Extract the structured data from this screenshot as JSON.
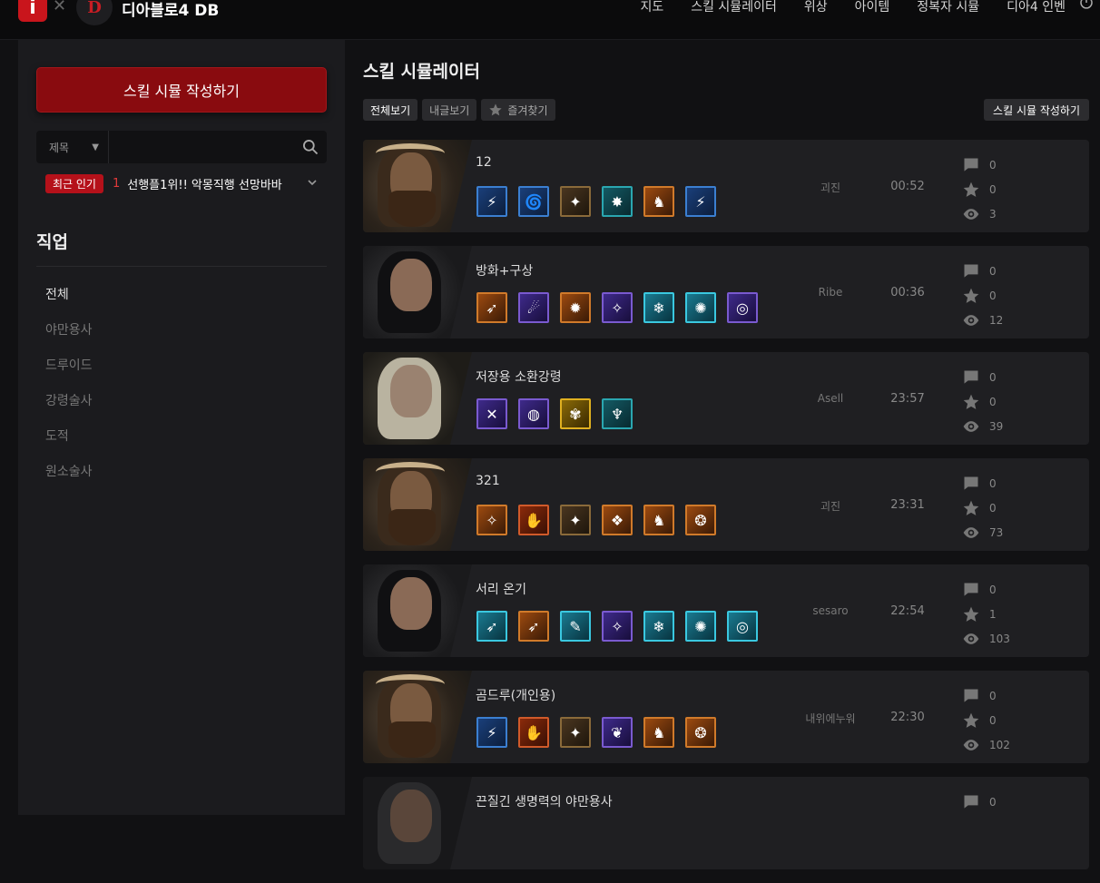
{
  "header": {
    "site_title": "디아블로4 DB",
    "logo_text": "i",
    "logo_d": "D",
    "nav": [
      "지도",
      "스킬 시뮬레이터",
      "위상",
      "아이템",
      "정복자 시뮬",
      "디아4 인벤"
    ]
  },
  "sidebar": {
    "write_button": "스킬 시뮬 작성하기",
    "search": {
      "select_label": "제목",
      "placeholder": ""
    },
    "trending": {
      "badge": "최근 인기",
      "rank": "1",
      "text": "선행플1위!! 악몽직행 선망바바"
    },
    "class_title": "직업",
    "classes": [
      "전체",
      "야만용사",
      "드루이드",
      "강령술사",
      "도적",
      "원소술사"
    ]
  },
  "main": {
    "title": "스킬 시뮬레이터",
    "tabs": {
      "all": "전체보기",
      "mine": "내글보기",
      "favorites": "즐겨찾기"
    },
    "write_button": "스킬 시뮬 작성하기",
    "cards": [
      {
        "title": "12",
        "author": "괴진",
        "time": "00:52",
        "comments": "0",
        "stars": "0",
        "views": "3",
        "portrait": "barbarian",
        "skills": [
          [
            "s-blue",
            "⚡"
          ],
          [
            "s-blue",
            "🌀"
          ],
          [
            "s-brown",
            "✦"
          ],
          [
            "s-teal",
            "✸"
          ],
          [
            "s-orange",
            "♞"
          ],
          [
            "s-blue",
            "⚡"
          ]
        ]
      },
      {
        "title": "방화+구상",
        "author": "Ribe",
        "time": "00:36",
        "comments": "0",
        "stars": "0",
        "views": "12",
        "portrait": "sorcerer",
        "skills": [
          [
            "s-orange",
            "➶"
          ],
          [
            "s-purple",
            "☄"
          ],
          [
            "s-orange",
            "✹"
          ],
          [
            "s-purple",
            "✧"
          ],
          [
            "s-cyan",
            "❄"
          ],
          [
            "s-cyan",
            "✺"
          ],
          [
            "s-purple",
            "◎"
          ]
        ]
      },
      {
        "title": "저장용 소환강령",
        "author": "Asell",
        "time": "23:57",
        "comments": "0",
        "stars": "0",
        "views": "39",
        "portrait": "necromancer",
        "skills": [
          [
            "s-purple",
            "✕"
          ],
          [
            "s-purple",
            "◍"
          ],
          [
            "s-gold",
            "✾"
          ],
          [
            "s-teal",
            "♆"
          ]
        ]
      },
      {
        "title": "321",
        "author": "괴진",
        "time": "23:31",
        "comments": "0",
        "stars": "0",
        "views": "73",
        "portrait": "barbarian",
        "skills": [
          [
            "s-orange",
            "✧"
          ],
          [
            "s-red",
            "✋"
          ],
          [
            "s-brown",
            "✦"
          ],
          [
            "s-orange",
            "❖"
          ],
          [
            "s-orange",
            "♞"
          ],
          [
            "s-orange",
            "❂"
          ]
        ]
      },
      {
        "title": "서리 온기",
        "author": "sesaro",
        "time": "22:54",
        "comments": "0",
        "stars": "1",
        "views": "103",
        "portrait": "sorcerer",
        "skills": [
          [
            "s-cyan",
            "➶"
          ],
          [
            "s-orange",
            "➶"
          ],
          [
            "s-cyan",
            "✎"
          ],
          [
            "s-purple",
            "✧"
          ],
          [
            "s-cyan",
            "❄"
          ],
          [
            "s-cyan",
            "✺"
          ],
          [
            "s-cyan",
            "◎"
          ]
        ]
      },
      {
        "title": "곰드루(개인용)",
        "author": "내위에누워",
        "time": "22:30",
        "comments": "0",
        "stars": "0",
        "views": "102",
        "portrait": "barbarian",
        "skills": [
          [
            "s-blue",
            "⚡"
          ],
          [
            "s-red",
            "✋"
          ],
          [
            "s-brown",
            "✦"
          ],
          [
            "s-purple",
            "❦"
          ],
          [
            "s-orange",
            "♞"
          ],
          [
            "s-orange",
            "❂"
          ]
        ]
      },
      {
        "title": "끈질긴 생명력의 야만용사",
        "author": "",
        "time": "",
        "comments": "0",
        "stars": "",
        "views": "",
        "portrait": "hooded",
        "skills": []
      }
    ]
  }
}
